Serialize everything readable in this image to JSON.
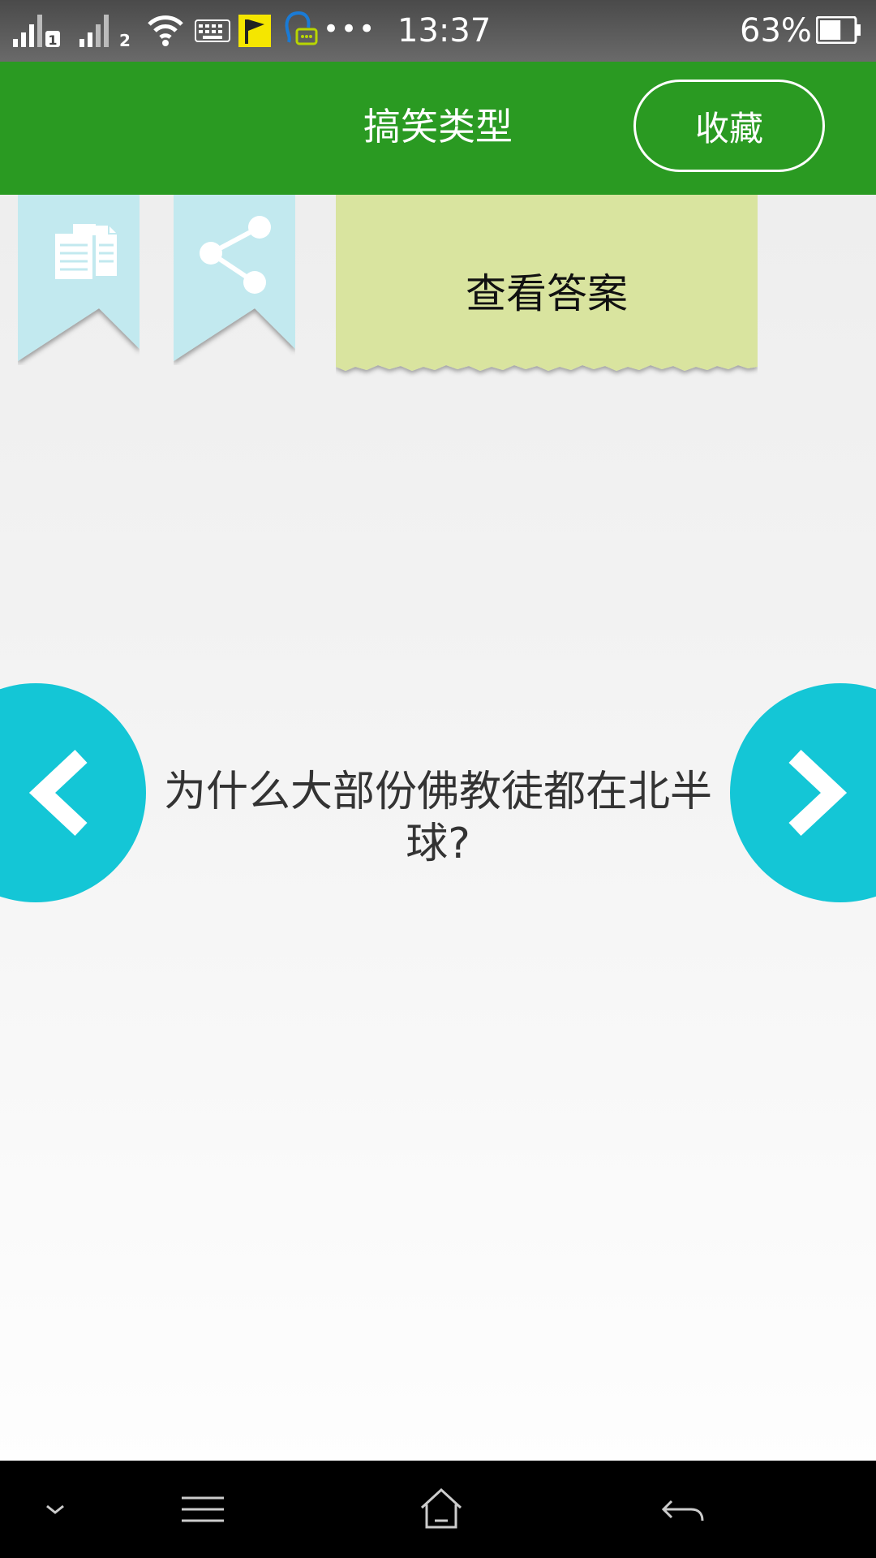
{
  "status_bar": {
    "time": "13:37",
    "battery_percent": "63%",
    "battery_level": 0.63,
    "sim1_label": "1",
    "sim2_label": "2",
    "more_glyph": "•••",
    "icons": [
      "signal-sim1-icon",
      "signal-sim2-icon",
      "wifi-icon",
      "keyboard-icon",
      "flag-icon",
      "chat-icon",
      "more-icon",
      "battery-icon"
    ]
  },
  "header": {
    "title": "搞笑类型",
    "favorite_label": "收藏"
  },
  "toolbar": {
    "copy_icon": "copy-icon",
    "share_icon": "share-icon",
    "answer_label": "查看答案"
  },
  "question": {
    "text": "为什么大部份佛教徒都在北半球?"
  },
  "navigation": {
    "prev_icon": "chevron-left-icon",
    "next_icon": "chevron-right-icon"
  },
  "system_nav": {
    "icons": [
      "chevron-down-icon",
      "menu-icon",
      "home-icon",
      "back-icon"
    ]
  },
  "colors": {
    "header_green": "#2a9a22",
    "ribbon_blue": "#c2e9ef",
    "note_yellow": "#d9e49f",
    "nav_cyan": "#14c6d6",
    "status_bar": "#5a5a5a",
    "system_bar": "#000000"
  }
}
